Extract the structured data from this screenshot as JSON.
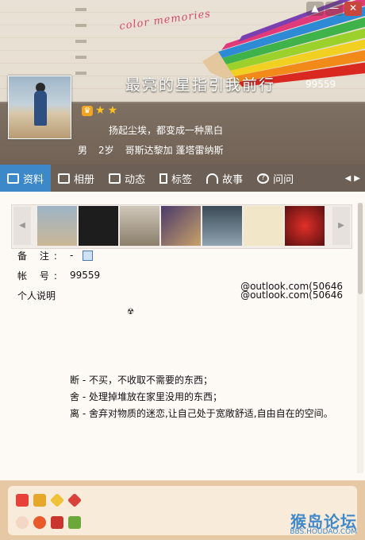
{
  "window": {
    "min_label": "—",
    "close_label": "✕",
    "pin_label": "▲"
  },
  "header": {
    "script_text": "color memories",
    "nickname": "最亮的星指引我前行",
    "uid": "99559",
    "signature": "扬起尘埃，都变成一种黑白",
    "gender": "男",
    "age": "2岁",
    "location": "哥斯达黎加 蓬塔雷纳斯",
    "level_icons": [
      "crown-icon",
      "star-icon",
      "star-icon"
    ]
  },
  "tabs": [
    {
      "label": "资料",
      "icon": "profile-card-icon",
      "active": true
    },
    {
      "label": "相册",
      "icon": "photo-album-icon"
    },
    {
      "label": "动态",
      "icon": "feed-icon"
    },
    {
      "label": "标签",
      "icon": "bookmark-icon"
    },
    {
      "label": "故事",
      "icon": "rainbow-icon"
    },
    {
      "label": "问问",
      "icon": "question-icon"
    }
  ],
  "tab_scroll": {
    "left": "◀",
    "right": "▶"
  },
  "photo_strip": {
    "left_arrow": "◀",
    "right_arrow": "▶",
    "thumbs": [
      "photo-beach",
      "photo-dark-portrait",
      "photo-street",
      "photo-bird",
      "photo-hand",
      "photo-cartoon",
      "photo-spiderweb"
    ]
  },
  "fields": {
    "remark_label": "备 注:",
    "remark_value": "-",
    "account_label": "帐 号:",
    "account_value": "99559",
    "bio_label": "个人说明",
    "email_1": "@outlook.com(50646",
    "email_2": "@outlook.com(50646"
  },
  "bio_icon": "☢",
  "bio_lines": [
    "断 - 不买，不收取不需要的东西；",
    "舍 - 处理掉堆放在家里没用的东西；",
    "离 - 舍弃对物质的迷恋,让自己处于宽敞舒适,自由自在的空间。"
  ],
  "footer_badges": [
    "heart-badge-icon",
    "gift-badge-icon",
    "diamond-badge-icon",
    "red-diamond-badge-icon",
    "pet-badge-icon",
    "game-badge-icon",
    "show-badge-icon",
    "music-badge-icon"
  ],
  "watermark": {
    "main": "猴岛论坛",
    "sub": "BBS.HOUDAO.COM"
  }
}
